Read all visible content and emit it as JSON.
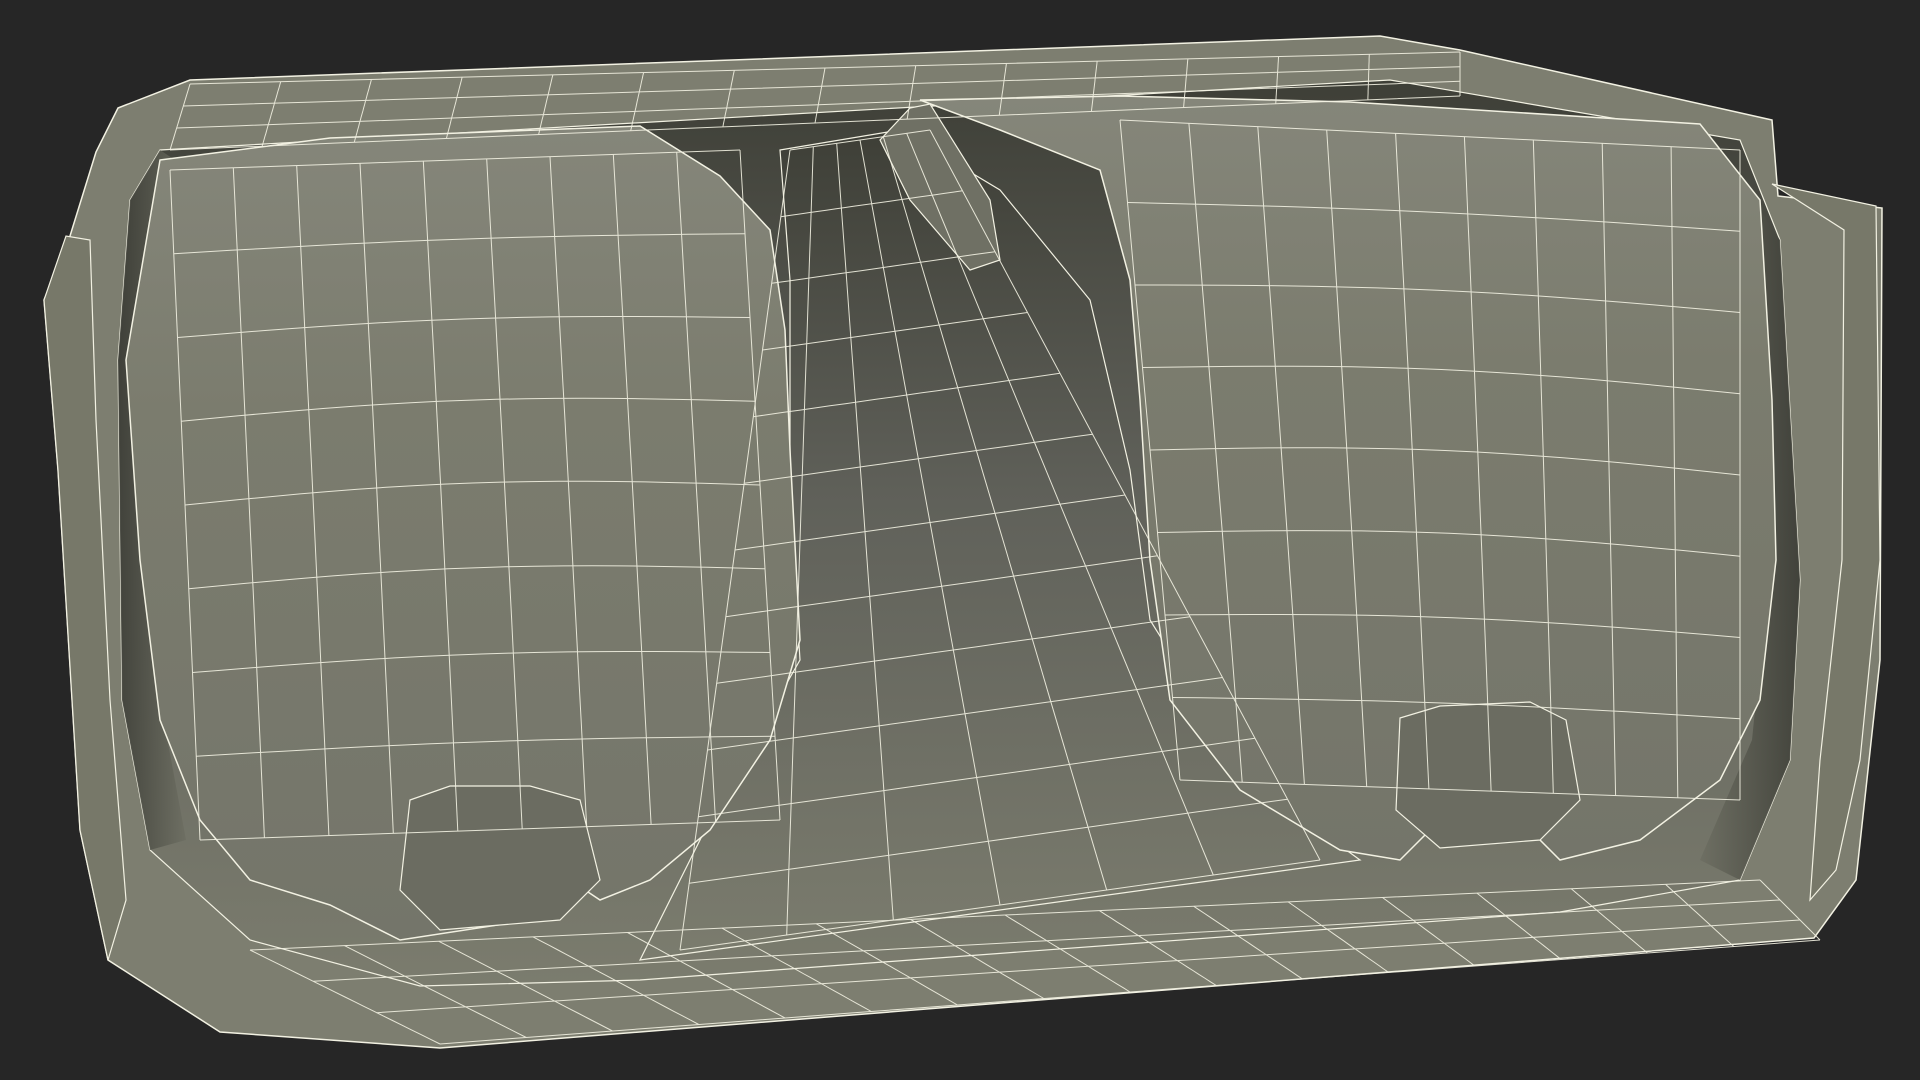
{
  "scene": {
    "subject": "wireframe-mesh-render",
    "colors": {
      "background": "#262626",
      "surface": "#7b7c6e",
      "surface_dark": "#5c5d52",
      "surface_shadow": "#3e3f37",
      "rim": "#8a8b7c",
      "wire": "#f2f1e2"
    }
  }
}
